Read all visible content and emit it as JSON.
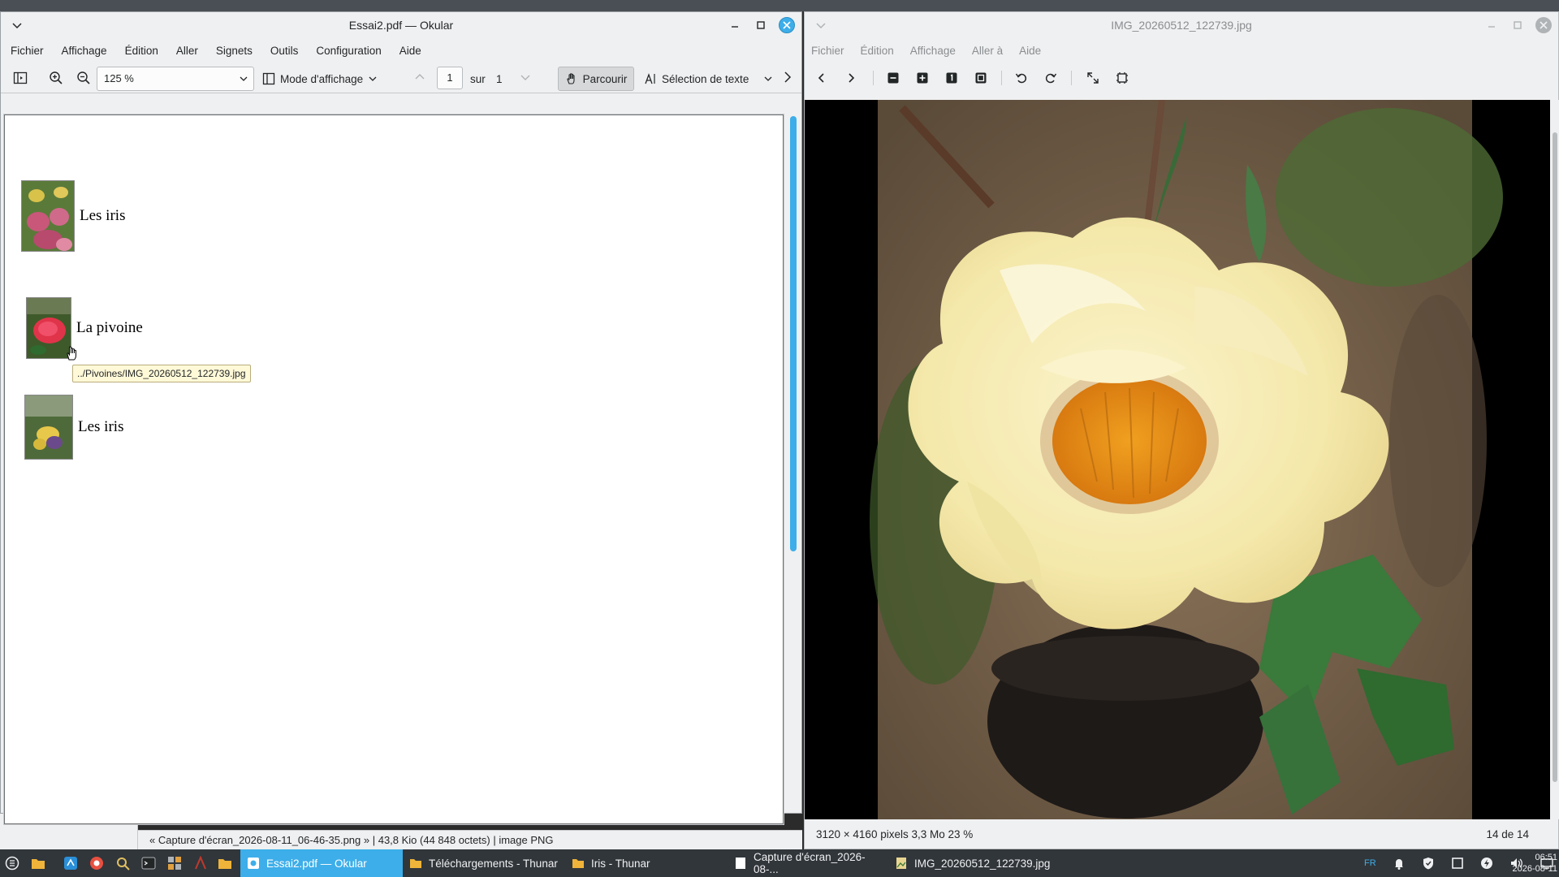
{
  "okular": {
    "title": "Essai2.pdf — Okular",
    "menu": [
      "Fichier",
      "Affichage",
      "Édition",
      "Aller",
      "Signets",
      "Outils",
      "Configuration",
      "Aide"
    ],
    "zoom_value": "125 %",
    "view_mode_label": "Mode d'affichage",
    "page_current": "1",
    "page_sep": "sur",
    "page_total": "1",
    "browse_label": "Parcourir",
    "text_select_label": "Sélection de texte",
    "entries": [
      {
        "label": "Les iris"
      },
      {
        "label": "La pivoine"
      },
      {
        "label": "Les iris"
      }
    ],
    "tooltip": "../Pivoines/IMG_20260512_122739.jpg"
  },
  "underlying_status": "« Capture d'écran_2026-08-11_06-46-35.png »  |  43,8 Kio (44 848 octets)  |  image PNG",
  "viewer": {
    "title": "IMG_20260512_122739.jpg",
    "menu": [
      "Fichier",
      "Édition",
      "Affichage",
      "Aller à",
      "Aide"
    ],
    "status_info": "3120 × 4160 pixels  3,3 Mo   23 %",
    "status_count": "14 de 14"
  },
  "taskbar": {
    "tasks": [
      {
        "label": "Essai2.pdf — Okular"
      },
      {
        "label": "Téléchargements - Thunar"
      },
      {
        "label": "Iris - Thunar"
      },
      {
        "label": "Capture d'écran_2026-08-..."
      },
      {
        "label": "IMG_20260512_122739.jpg"
      }
    ],
    "keyboard_layout": "FR",
    "time": "06:51",
    "date": "2026-08-11"
  }
}
